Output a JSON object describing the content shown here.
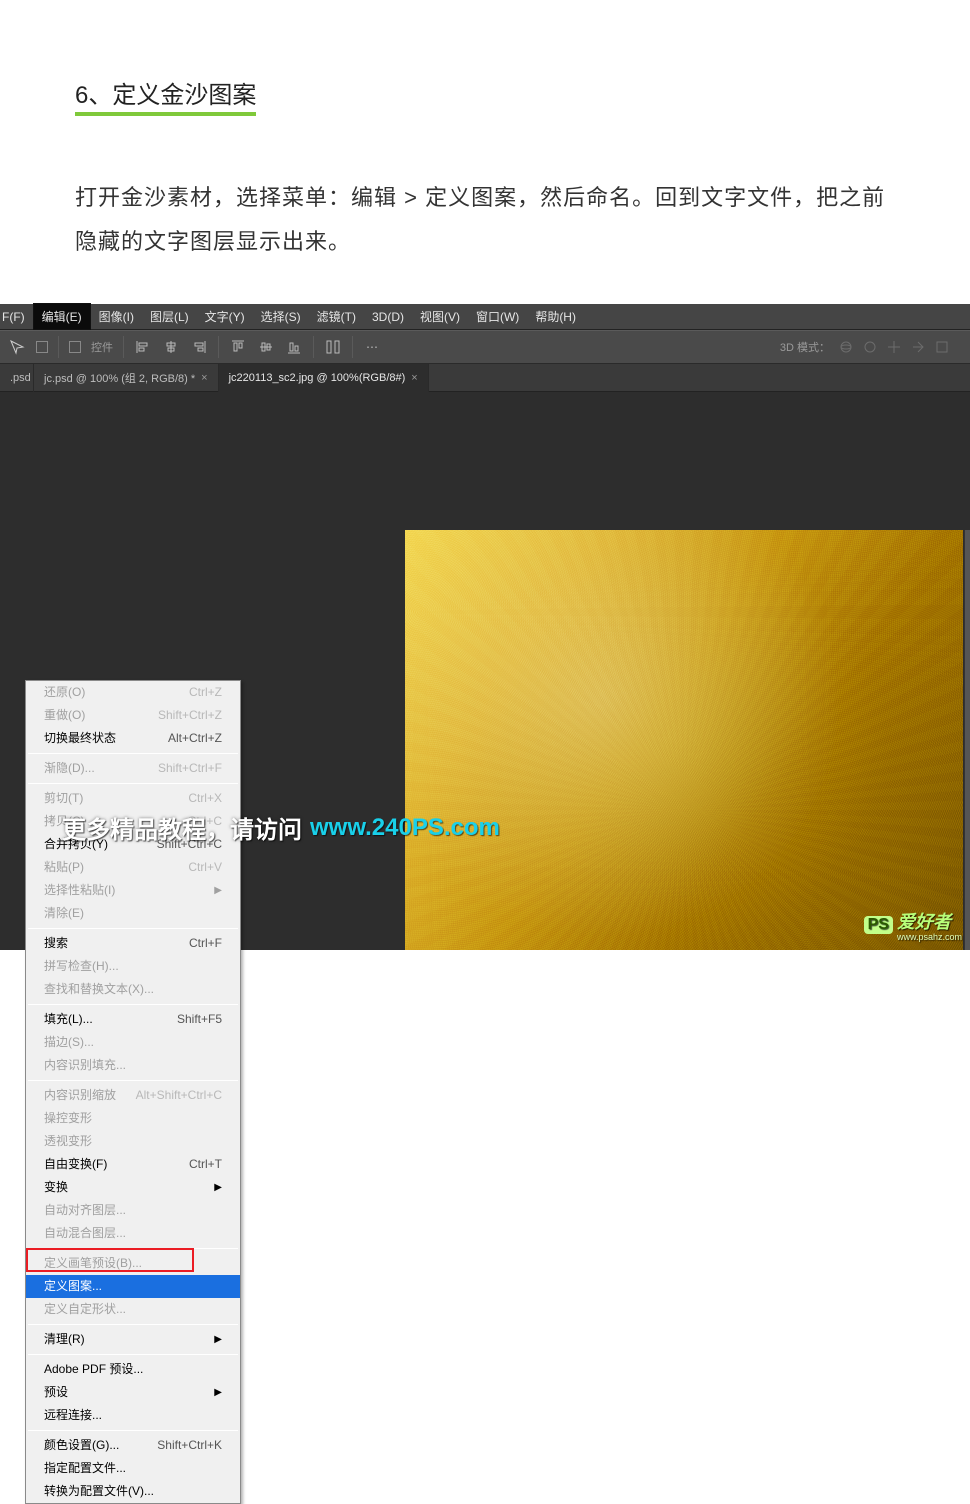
{
  "article": {
    "step_title": "6、定义金沙图案",
    "step_body": "打开金沙素材，选择菜单：编辑 > 定义图案，然后命名。回到文字文件，把之前隐藏的文字图层显示出来。"
  },
  "menubar": {
    "file_trunc": "F(F)",
    "edit": "编辑(E)",
    "image": "图像(I)",
    "layer": "图层(L)",
    "type": "文字(Y)",
    "select": "选择(S)",
    "filter": "滤镜(T)",
    "three_d": "3D(D)",
    "view": "视图(V)",
    "window": "窗口(W)",
    "help": "帮助(H)"
  },
  "optbar": {
    "controls_label": "控件",
    "mode3d_label": "3D 模式："
  },
  "tabs": {
    "t0": ".psd",
    "t1": "jc.psd @ 100% (组 2, RGB/8) *",
    "t2": "jc220113_sc2.jpg @ 100%(RGB/8#)"
  },
  "edit_menu": {
    "undo": "还原(O)",
    "undo_sc": "Ctrl+Z",
    "redo": "重做(O)",
    "redo_sc": "Shift+Ctrl+Z",
    "toggle_last": "切换最终状态",
    "toggle_last_sc": "Alt+Ctrl+Z",
    "fade": "渐隐(D)...",
    "fade_sc": "Shift+Ctrl+F",
    "cut": "剪切(T)",
    "cut_sc": "Ctrl+X",
    "copy": "拷贝(C)",
    "copy_sc": "Ctrl+C",
    "copy_merged": "合并拷贝(Y)",
    "copy_merged_sc": "Shift+Ctrl+C",
    "paste": "粘贴(P)",
    "paste_sc": "Ctrl+V",
    "paste_special": "选择性粘贴(I)",
    "clear": "清除(E)",
    "search": "搜索",
    "search_sc": "Ctrl+F",
    "spell": "拼写检查(H)...",
    "find_replace": "查找和替换文本(X)...",
    "fill": "填充(L)...",
    "fill_sc": "Shift+F5",
    "stroke": "描边(S)...",
    "content_fill": "内容识别填充...",
    "content_scale": "内容识别缩放",
    "content_scale_sc": "Alt+Shift+Ctrl+C",
    "puppet": "操控变形",
    "perspective": "透视变形",
    "free_transform": "自由变换(F)",
    "free_transform_sc": "Ctrl+T",
    "transform": "变换",
    "auto_align": "自动对齐图层...",
    "auto_blend": "自动混合图层...",
    "define_brush": "定义画笔预设(B)...",
    "define_pattern": "定义图案...",
    "define_shape": "定义自定形状...",
    "purge": "清理(R)",
    "adobe_pdf": "Adobe PDF 预设...",
    "presets": "预设",
    "remote": "远程连接...",
    "color_settings": "颜色设置(G)...",
    "color_settings_sc": "Shift+Ctrl+K",
    "assign_profile": "指定配置文件...",
    "convert_profile": "转换为配置文件(V)..."
  },
  "overlay": {
    "text": "更多精品教程，请访问",
    "link": "www.240PS.com"
  },
  "watermark": {
    "ps": "PS",
    "name": "爱好者",
    "url": "www.psahz.com"
  }
}
